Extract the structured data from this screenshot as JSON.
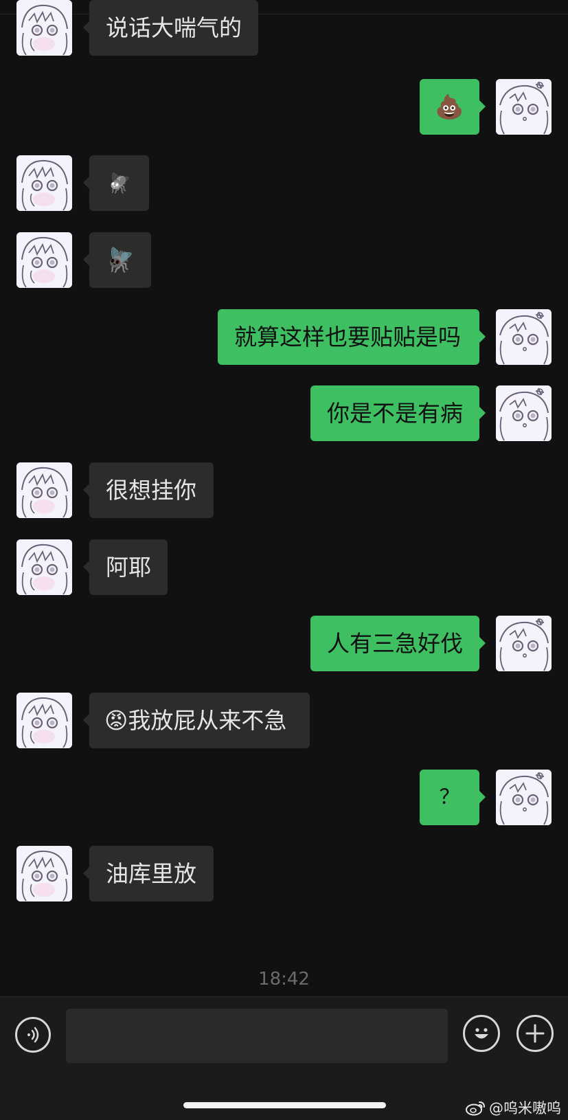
{
  "messages": [
    {
      "side": "left",
      "text": "说话大喘气的"
    },
    {
      "side": "right",
      "text": "💩"
    },
    {
      "side": "left",
      "text": "🪰"
    },
    {
      "side": "left",
      "text": "🪰"
    },
    {
      "side": "right",
      "text": "就算这样也要贴贴是吗"
    },
    {
      "side": "right",
      "text": "你是不是有病"
    },
    {
      "side": "left",
      "text": "很想挂你"
    },
    {
      "side": "left",
      "text": "阿耶"
    },
    {
      "side": "right",
      "text": "人有三急好伐"
    },
    {
      "side": "left",
      "text": "😡我放屁从来不急"
    },
    {
      "side": "right",
      "text": "？"
    },
    {
      "side": "left",
      "text": "油库里放"
    }
  ],
  "timestamp": "18:42",
  "input": {
    "value": "",
    "placeholder": ""
  },
  "icons": {
    "voice": "voice-input-icon",
    "emoji": "emoji-icon",
    "plus": "plus-icon",
    "avatar_left": "anime-girl-avatar",
    "avatar_right": "anime-girl-avatar"
  },
  "watermark": "@呜米嗷呜",
  "colors": {
    "background": "#111111",
    "bubble_left": "#2c2c2c",
    "bubble_right": "#3dbf62",
    "text_left": "#e6e6e6",
    "text_right": "#111111"
  }
}
